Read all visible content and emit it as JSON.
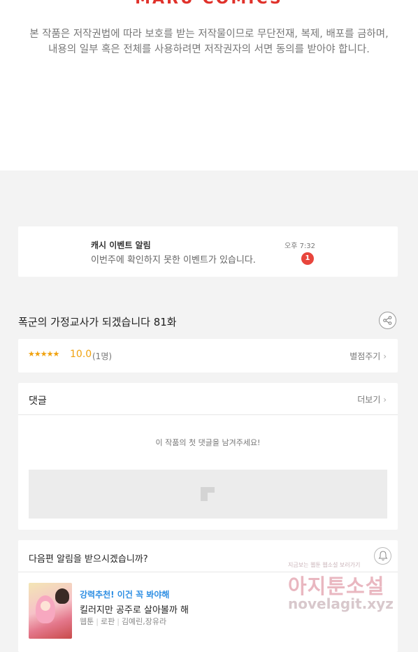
{
  "top": {
    "logo": "MARU COMICS",
    "copyright_line1": "본 작품은 저작권법에 따라 보호를 받는 저작물이므로 무단전재, 복제,  배포를 금하며,",
    "copyright_line2": "내용의 일부 혹은 전체를 사용하려면 저작권자의 서면 동의를 받아야 합니다."
  },
  "notification": {
    "title": "캐시 이벤트 알림",
    "message": "이번주에 확인하지 못한 이벤트가 있습니다.",
    "time": "오후 7:32",
    "badge": "1"
  },
  "episode": {
    "title": "폭군의 가정교사가 되겠습니다 81화",
    "share_icon": "share-icon"
  },
  "rating": {
    "stars": "★★★★★",
    "score": "10.0",
    "count": "(1명)",
    "rate_link": "별점주기"
  },
  "comments": {
    "heading": "댓글",
    "more": "더보기",
    "empty": "이 작품의 첫 댓글을 남겨주세요!"
  },
  "next": {
    "heading": "다음편 알림을 받으시겠습니까?",
    "recommend_title": "강력추천! 이건 꼭 봐야해",
    "recommend_name": "킬러지만 공주로 살아볼까 해",
    "meta_type": "웹툰",
    "meta_genre": "로판",
    "meta_authors": "김예린,장유라"
  },
  "watermark": {
    "tagline": "지금보는 웹툰 웹소설 보러가기",
    "brand": "아지툰소설",
    "url": "novelagit.xyz"
  },
  "colors": {
    "accent_red": "#e0322b",
    "star": "#f0a20f",
    "badge": "#e8453c",
    "link_blue": "#2f8fe3"
  }
}
